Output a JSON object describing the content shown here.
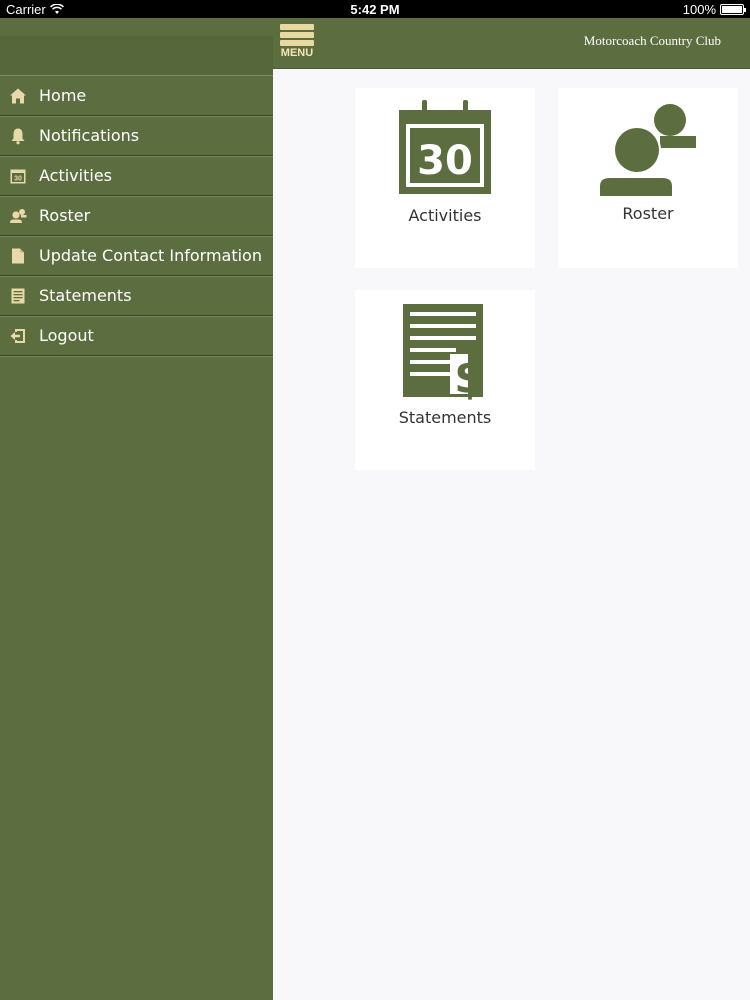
{
  "status_bar": {
    "carrier": "Carrier",
    "time": "5:42 PM",
    "battery": "100%"
  },
  "sidebar": {
    "items": [
      {
        "label": "Home",
        "icon": "home-icon"
      },
      {
        "label": "Notifications",
        "icon": "bell-icon"
      },
      {
        "label": "Activities",
        "icon": "calendar-icon"
      },
      {
        "label": "Roster",
        "icon": "people-icon"
      },
      {
        "label": "Update Contact Information",
        "icon": "document-icon"
      },
      {
        "label": "Statements",
        "icon": "statement-icon"
      },
      {
        "label": "Logout",
        "icon": "logout-icon"
      }
    ]
  },
  "topbar": {
    "menu_label": "MENU",
    "club_name": "Motorcoach Country Club"
  },
  "tiles": [
    {
      "label": "Activities",
      "icon": "calendar-icon",
      "calendar_day": "30"
    },
    {
      "label": "Roster",
      "icon": "people-icon"
    },
    {
      "label": "Statements",
      "icon": "statement-icon",
      "currency_symbol": "$"
    }
  ],
  "colors": {
    "brand_green": "#5c6e40",
    "menu_gold": "#e8d9a2",
    "icon_tan": "#e7d9a8",
    "content_bg": "#f8f8fa"
  }
}
